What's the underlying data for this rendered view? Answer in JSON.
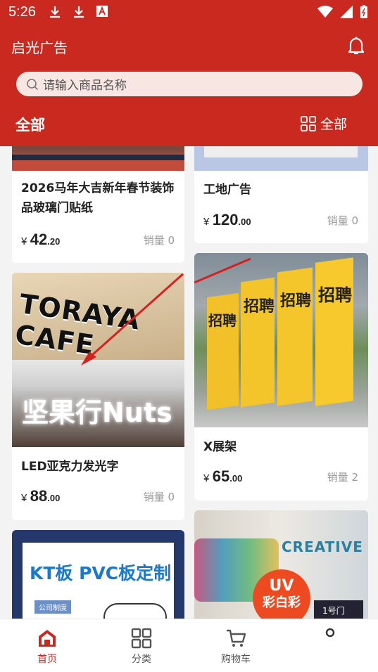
{
  "status": {
    "time": "5:26"
  },
  "header": {
    "title": "启光广告",
    "search_placeholder": "请输入商品名称",
    "tab_all": "全部",
    "category_all": "全部"
  },
  "colors": {
    "brand": "#c9291f",
    "price_text": "#222222",
    "muted": "#999999"
  },
  "products": [
    {
      "name": "2026马年大吉新年春节装饰品玻璃门贴纸",
      "currency": "¥",
      "price_int": "42",
      "price_dec": ".20",
      "sales": "销量 0"
    },
    {
      "name": "工地广告",
      "currency": "¥",
      "price_int": "120",
      "price_dec": ".00",
      "sales": "销量 0"
    },
    {
      "name": "LED亚克力发光字",
      "currency": "¥",
      "price_int": "88",
      "price_dec": ".00",
      "sales": "销量 0",
      "image_text_top": "TORAYA CAFE",
      "image_text_bottom": "坚果行Nuts"
    },
    {
      "name": "X展架",
      "currency": "¥",
      "price_int": "65",
      "price_dec": ".00",
      "sales": "销量 2",
      "image_text": "招聘"
    },
    {
      "name": "",
      "image_text": "KT板 PVC板定制",
      "image_sub": "公司制度"
    },
    {
      "name": "",
      "image_text": "CREATIVE",
      "badge_line1": "UV",
      "badge_line2": "彩白彩",
      "door_sign": "1号门"
    }
  ],
  "bottom_nav": [
    {
      "label": "首页",
      "icon": "home-icon",
      "active": true
    },
    {
      "label": "分类",
      "icon": "grid-icon",
      "active": false
    },
    {
      "label": "购物车",
      "icon": "cart-icon",
      "active": false
    },
    {
      "label": "",
      "icon": "user-icon",
      "active": false
    }
  ]
}
